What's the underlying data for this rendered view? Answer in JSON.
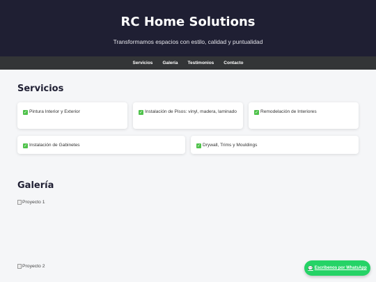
{
  "hero": {
    "title": "RC Home Solutions",
    "subtitle": "Transformamos espacios con estilo, calidad y puntualidad"
  },
  "nav": {
    "items": [
      {
        "label": "Servicios"
      },
      {
        "label": "Galería"
      },
      {
        "label": "Testimonios"
      },
      {
        "label": "Contacto"
      }
    ]
  },
  "servicios": {
    "title": "Servicios",
    "items": [
      {
        "label": "Pintura Interior y Exterior",
        "icon": "check-icon"
      },
      {
        "label": "Instalación de Pisos: vinyl, madera, laminado",
        "icon": "check-icon"
      },
      {
        "label": "Remodelación de Interiores",
        "icon": "check-icon"
      },
      {
        "label": "Instalación de Gabinetes",
        "icon": "check-icon"
      },
      {
        "label": "Drywall, Trims y Mouldings",
        "icon": "check-icon"
      }
    ]
  },
  "galeria": {
    "title": "Galería",
    "images": [
      {
        "alt": "Proyecto 1"
      },
      {
        "alt": "Proyecto 2"
      }
    ]
  },
  "whatsapp": {
    "label": "Escríbenos por WhatsApp",
    "icon": "chat-icon",
    "color": "#25d366"
  },
  "colors": {
    "hero_bg": "#1f1f33",
    "nav_bg": "#333537",
    "page_bg": "#f5f6f8",
    "check": "#4fc24b"
  }
}
